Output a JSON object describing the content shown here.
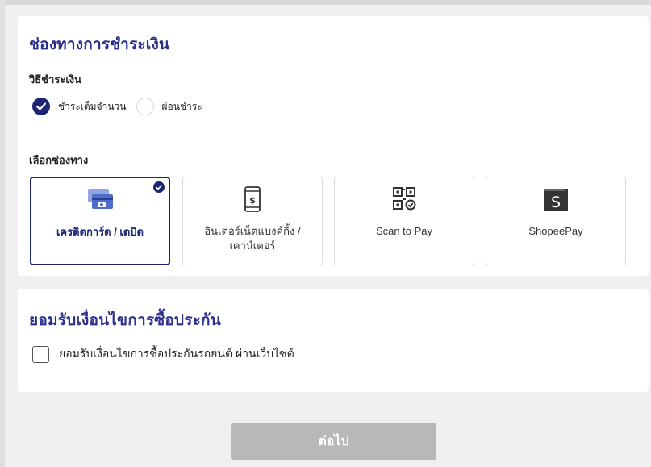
{
  "payment": {
    "title": "ช่องทางการชำระเงิน",
    "method_label": "วิธีชำระเงิน",
    "methods": [
      {
        "label": "ชำระเต็มจำนวน",
        "checked": true
      },
      {
        "label": "ผ่อนชำระ",
        "checked": false
      }
    ],
    "channel_label": "เลือกช่องทาง",
    "channels": [
      {
        "label": "เครดิตการ์ด / เดบิต",
        "icon": "credit-card-icon",
        "selected": true
      },
      {
        "label": "อินเตอร์เน็ตแบงค์กิ้ง / เคาน์เตอร์",
        "icon": "mobile-banking-icon",
        "selected": false
      },
      {
        "label": "Scan to Pay",
        "icon": "qr-code-icon",
        "selected": false
      },
      {
        "label": "ShopeePay",
        "icon": "shopeepay-icon",
        "selected": false
      }
    ]
  },
  "agreement": {
    "title": "ยอมรับเงื่อนไขการซื้อประกัน",
    "checkbox_label": "ยอมรับเงื่อนไขการซื้อประกันรถยนต์ ผ่านเว็บไซต์",
    "checked": false
  },
  "next_button": {
    "label": "ต่อไป",
    "enabled": false
  },
  "colors": {
    "accent": "#1d2375",
    "title": "#2a2f8c",
    "card_icon": "#4f6cc8",
    "background": "#f0f0f0",
    "disabled_button": "#b8b8b8"
  }
}
